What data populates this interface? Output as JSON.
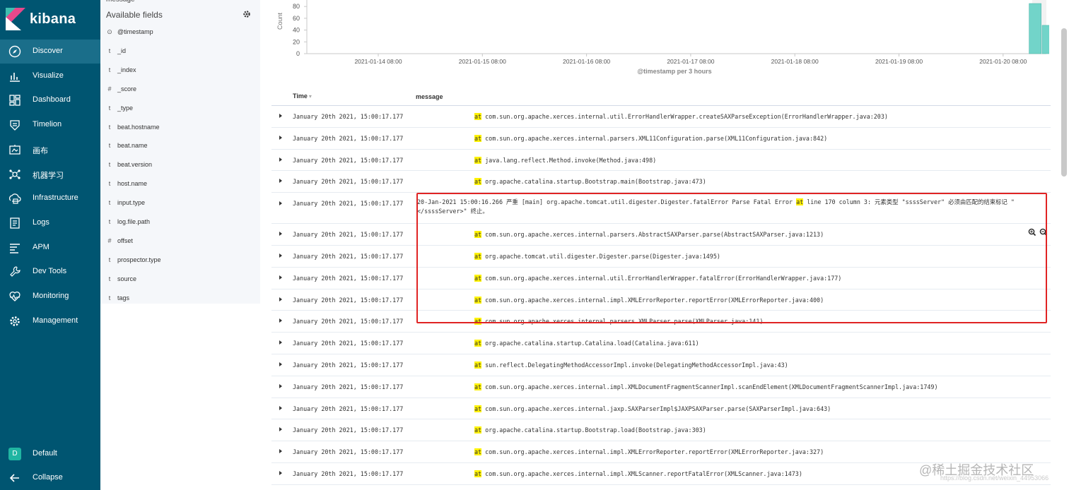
{
  "app": {
    "brand": "kibana"
  },
  "sidebar": {
    "items": [
      {
        "label": "Discover",
        "icon": "compass-icon"
      },
      {
        "label": "Visualize",
        "icon": "bar-chart-icon"
      },
      {
        "label": "Dashboard",
        "icon": "dashboard-icon"
      },
      {
        "label": "Timelion",
        "icon": "timelion-icon"
      },
      {
        "label": "画布",
        "icon": "canvas-icon"
      },
      {
        "label": "机器学习",
        "icon": "ml-icon"
      },
      {
        "label": "Infrastructure",
        "icon": "infrastructure-icon"
      },
      {
        "label": "Logs",
        "icon": "logs-icon"
      },
      {
        "label": "APM",
        "icon": "apm-icon"
      },
      {
        "label": "Dev Tools",
        "icon": "wrench-icon"
      },
      {
        "label": "Monitoring",
        "icon": "heartbeat-icon"
      },
      {
        "label": "Management",
        "icon": "gear-icon"
      }
    ],
    "active": "Discover",
    "space": {
      "badge": "D",
      "label": "Default"
    },
    "collapse": "Collapse"
  },
  "fields": {
    "partial_label": "message",
    "title": "Available fields",
    "items": [
      {
        "type": "⊙",
        "name": "@timestamp"
      },
      {
        "type": "t",
        "name": "_id"
      },
      {
        "type": "t",
        "name": "_index"
      },
      {
        "type": "#",
        "name": "_score"
      },
      {
        "type": "t",
        "name": "_type"
      },
      {
        "type": "t",
        "name": "beat.hostname"
      },
      {
        "type": "t",
        "name": "beat.name"
      },
      {
        "type": "t",
        "name": "beat.version"
      },
      {
        "type": "t",
        "name": "host.name"
      },
      {
        "type": "t",
        "name": "input.type"
      },
      {
        "type": "t",
        "name": "log.file.path"
      },
      {
        "type": "#",
        "name": "offset"
      },
      {
        "type": "t",
        "name": "prospector.type"
      },
      {
        "type": "t",
        "name": "source"
      },
      {
        "type": "t",
        "name": "tags"
      }
    ]
  },
  "chart_data": {
    "type": "bar",
    "ylabel": "Count",
    "xlabel": "@timestamp per 3 hours",
    "yticks": [
      0,
      20,
      40,
      60,
      80
    ],
    "ylim": [
      0,
      85
    ],
    "xticks": [
      "2021-01-14 08:00",
      "2021-01-15 08:00",
      "2021-01-16 08:00",
      "2021-01-17 08:00",
      "2021-01-18 08:00",
      "2021-01-19 08:00",
      "2021-01-20 08:00"
    ],
    "bars": [
      {
        "x": "2021-01-20 14:00",
        "value": 85,
        "color": "#72d4c9"
      },
      {
        "x": "2021-01-20 17:00",
        "value": 48,
        "color": "#72d4c9"
      }
    ],
    "grid": false
  },
  "table": {
    "headers": {
      "time": "Time",
      "sort": "▾",
      "message": "message"
    },
    "highlight_term": "at",
    "rows": [
      {
        "time": "January 20th 2021, 15:00:17.177",
        "pre": "",
        "msg": " com.sun.org.apache.xerces.internal.util.ErrorHandlerWrapper.createSAXParseException(ErrorHandlerWrapper.java:203)"
      },
      {
        "time": "January 20th 2021, 15:00:17.177",
        "pre": "",
        "msg": " com.sun.org.apache.xerces.internal.parsers.XML11Configuration.parse(XML11Configuration.java:842)"
      },
      {
        "time": "January 20th 2021, 15:00:17.177",
        "pre": "",
        "msg": " java.lang.reflect.Method.invoke(Method.java:498)"
      },
      {
        "time": "January 20th 2021, 15:00:17.177",
        "pre": "",
        "msg": " org.apache.catalina.startup.Bootstrap.main(Bootstrap.java:473)"
      },
      {
        "time": "January 20th 2021, 15:00:17.177",
        "wide": true,
        "pre": "20-Jan-2021 15:00:16.266 严重 [main] org.apache.tomcat.util.digester.Digester.fatalError Parse Fatal Error ",
        "msg": " line 170 column 3: 元素类型 \"ssssServer\" 必须由匹配的结束标记 \"</ssssServer>\" 终止。"
      },
      {
        "time": "January 20th 2021, 15:00:17.177",
        "pre": "",
        "msg": " com.sun.org.apache.xerces.internal.parsers.AbstractSAXParser.parse(AbstractSAXParser.java:1213)",
        "tools": true
      },
      {
        "time": "January 20th 2021, 15:00:17.177",
        "pre": "",
        "msg": " org.apache.tomcat.util.digester.Digester.parse(Digester.java:1495)"
      },
      {
        "time": "January 20th 2021, 15:00:17.177",
        "pre": "",
        "msg": " com.sun.org.apache.xerces.internal.util.ErrorHandlerWrapper.fatalError(ErrorHandlerWrapper.java:177)"
      },
      {
        "time": "January 20th 2021, 15:00:17.177",
        "pre": "",
        "msg": " com.sun.org.apache.xerces.internal.impl.XMLErrorReporter.reportError(XMLErrorReporter.java:400)"
      },
      {
        "time": "January 20th 2021, 15:00:17.177",
        "pre": "",
        "msg": " com.sun.org.apache.xerces.internal.parsers.XMLParser.parse(XMLParser.java:141)"
      },
      {
        "time": "January 20th 2021, 15:00:17.177",
        "pre": "",
        "msg": " org.apache.catalina.startup.Catalina.load(Catalina.java:611)"
      },
      {
        "time": "January 20th 2021, 15:00:17.177",
        "pre": "",
        "msg": " sun.reflect.DelegatingMethodAccessorImpl.invoke(DelegatingMethodAccessorImpl.java:43)"
      },
      {
        "time": "January 20th 2021, 15:00:17.177",
        "pre": "",
        "msg": " com.sun.org.apache.xerces.internal.impl.XMLDocumentFragmentScannerImpl.scanEndElement(XMLDocumentFragmentScannerImpl.java:1749)"
      },
      {
        "time": "January 20th 2021, 15:00:17.177",
        "pre": "",
        "msg": " com.sun.org.apache.xerces.internal.jaxp.SAXParserImpl$JAXPSAXParser.parse(SAXParserImpl.java:643)"
      },
      {
        "time": "January 20th 2021, 15:00:17.177",
        "pre": "",
        "msg": " org.apache.catalina.startup.Bootstrap.load(Bootstrap.java:303)"
      },
      {
        "time": "January 20th 2021, 15:00:17.177",
        "pre": "",
        "msg": " com.sun.org.apache.xerces.internal.impl.XMLErrorReporter.reportError(XMLErrorReporter.java:327)"
      },
      {
        "time": "January 20th 2021, 15:00:17.177",
        "pre": "",
        "msg": " com.sun.org.apache.xerces.internal.impl.XMLScanner.reportFatalError(XMLScanner.java:1473)"
      }
    ]
  },
  "watermark": {
    "line1": "@稀土掘金技术社区",
    "line2": "https://blog.csdn.net/weixin_44953066"
  },
  "colors": {
    "sidebar": "#005571",
    "active": "#1a6e8a",
    "bar": "#72d4c9",
    "highlight": "#fff200",
    "annotation": "#e02424"
  }
}
